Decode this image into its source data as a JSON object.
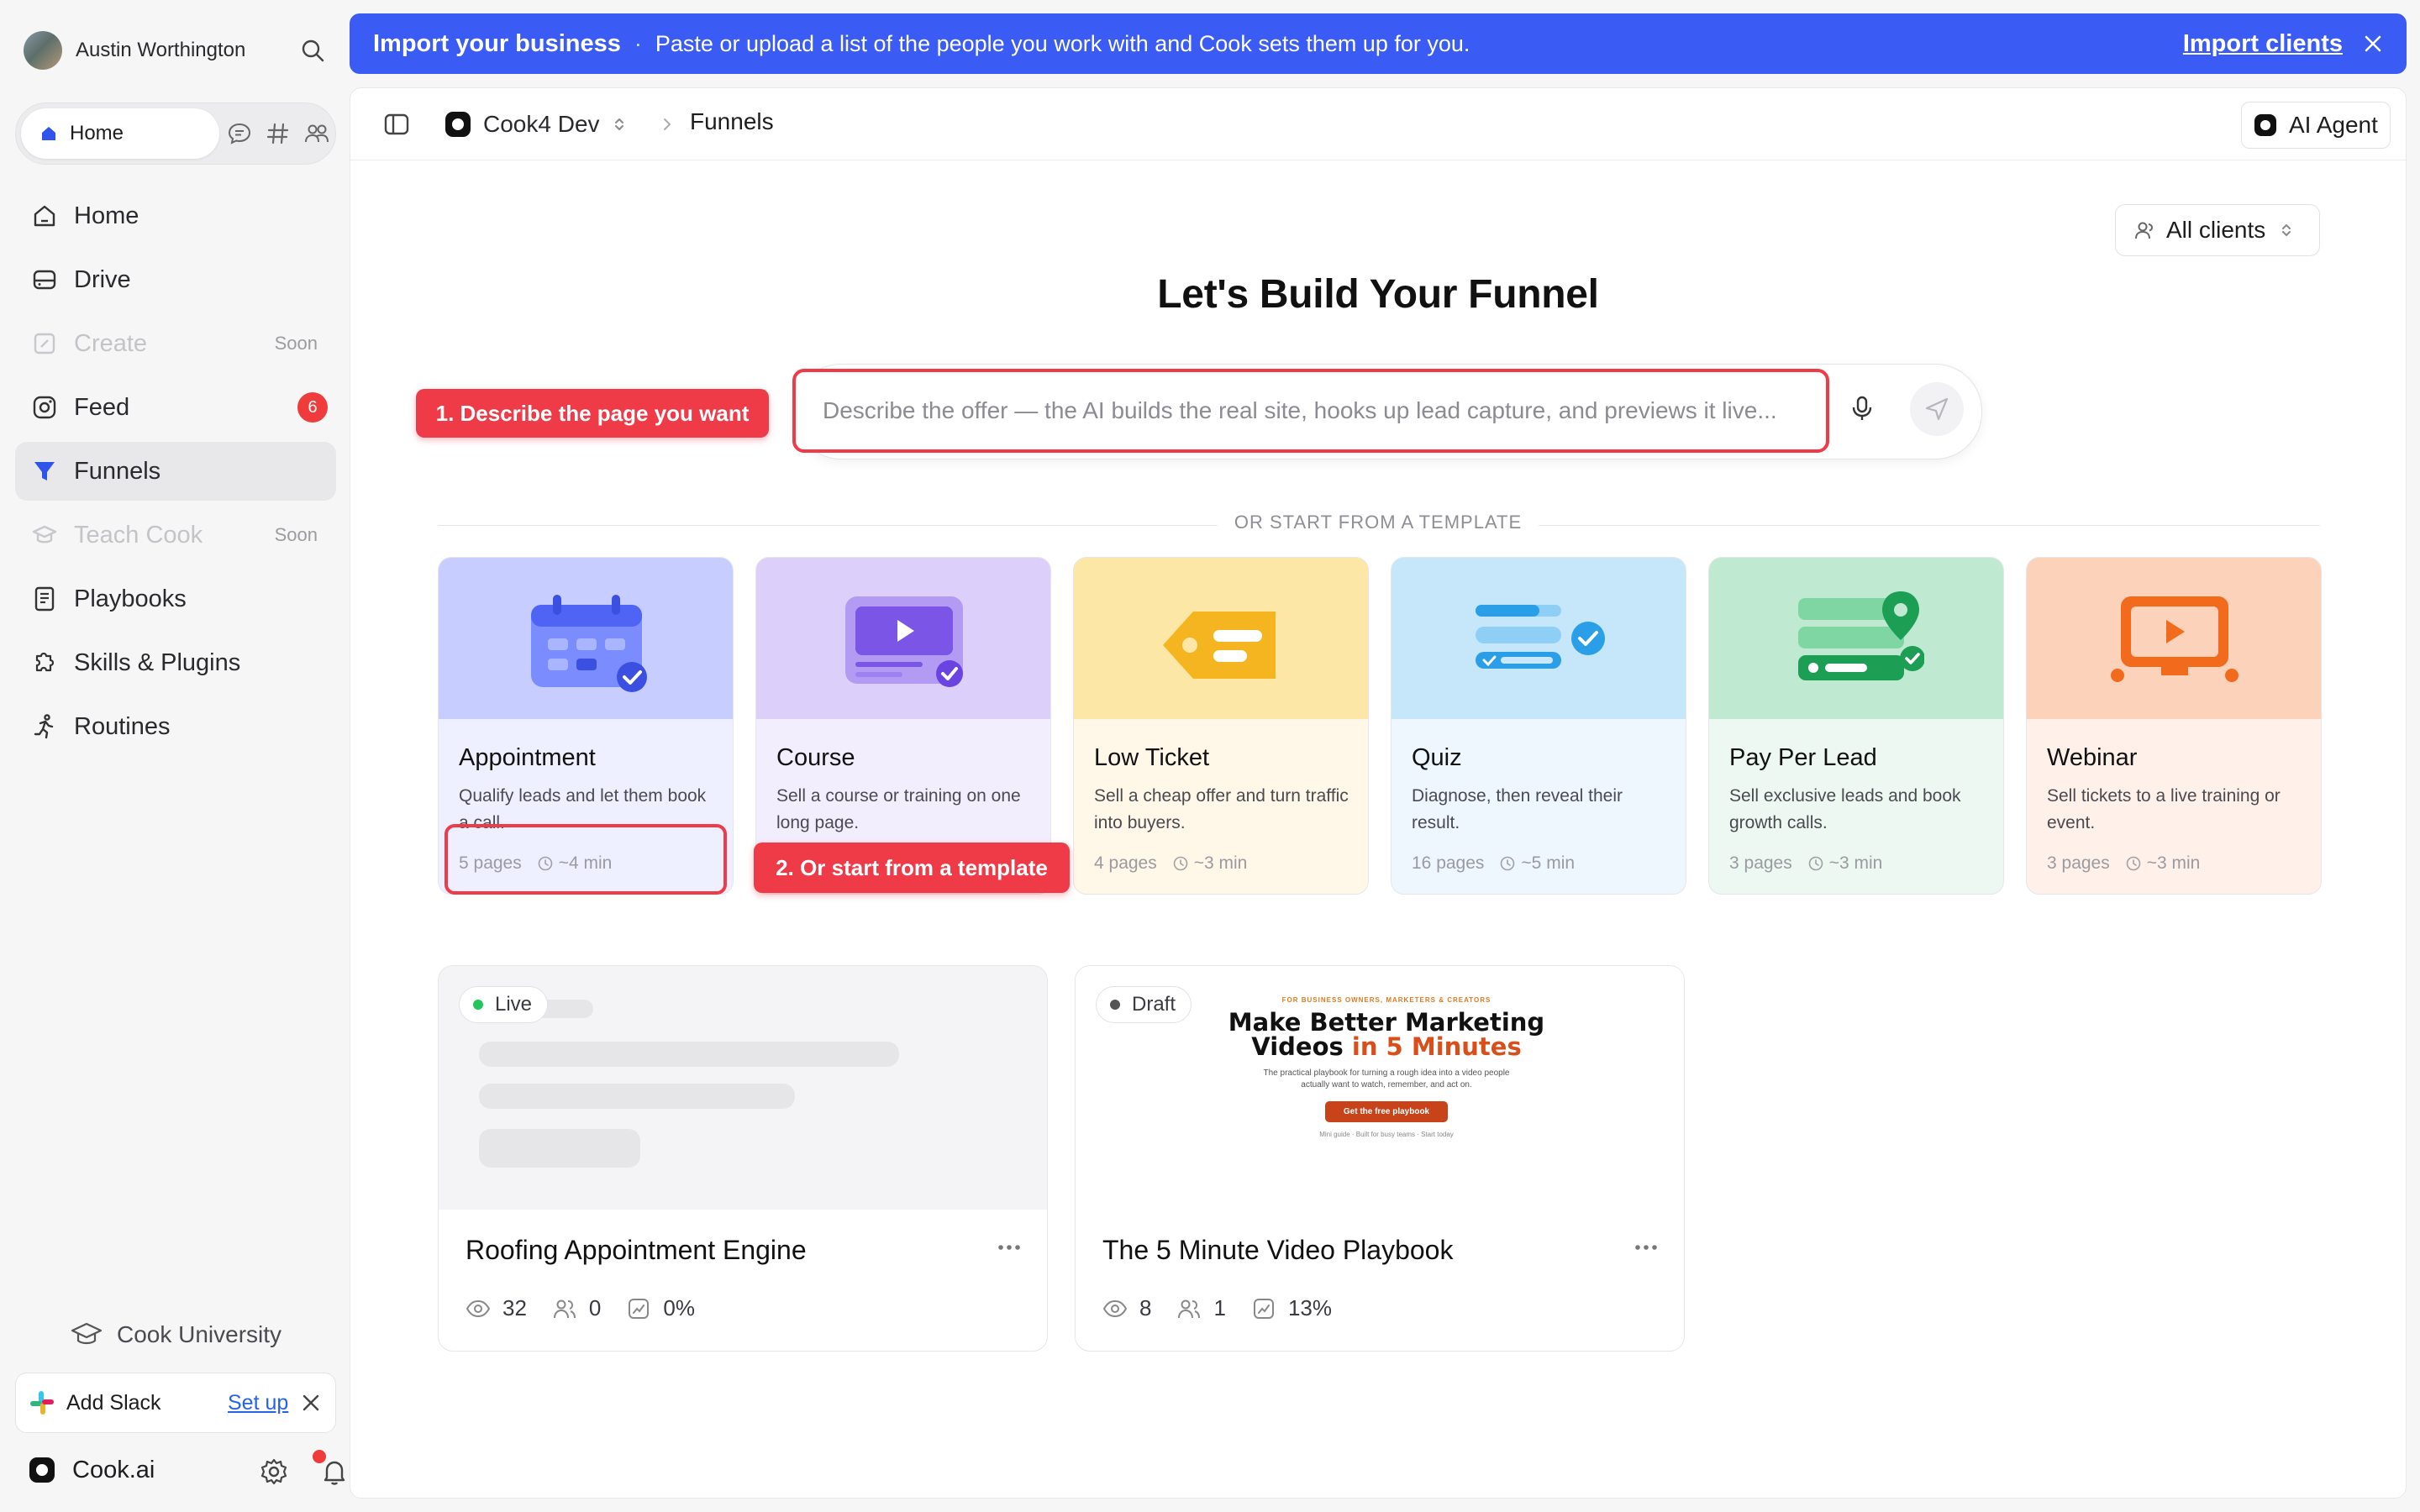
{
  "user": {
    "name": "Austin Worthington"
  },
  "mode_switch": {
    "active_label": "Home"
  },
  "nav": [
    {
      "label": "Home",
      "icon": "home-icon",
      "state": "normal"
    },
    {
      "label": "Drive",
      "icon": "drive-icon",
      "state": "normal"
    },
    {
      "label": "Create",
      "icon": "create-icon",
      "state": "disabled",
      "tag": "Soon"
    },
    {
      "label": "Feed",
      "icon": "feed-icon",
      "state": "normal",
      "badge": "6"
    },
    {
      "label": "Funnels",
      "icon": "funnel-icon",
      "state": "active"
    },
    {
      "label": "Teach Cook",
      "icon": "teach-icon",
      "state": "disabled",
      "tag": "Soon"
    },
    {
      "label": "Playbooks",
      "icon": "playbook-icon",
      "state": "normal"
    },
    {
      "label": "Skills & Plugins",
      "icon": "puzzle-icon",
      "state": "normal"
    },
    {
      "label": "Routines",
      "icon": "routine-icon",
      "state": "normal"
    }
  ],
  "sidebar_footer": {
    "university": "Cook University",
    "slack_label": "Add Slack",
    "slack_action": "Set up",
    "brand": "Cook.ai"
  },
  "banner": {
    "title": "Import your business",
    "separator": "·",
    "message": "Paste or upload a list of the people you work with and Cook sets them up for you.",
    "action": "Import clients",
    "color": "#3b5bf5"
  },
  "topbar": {
    "workspace": "Cook4 Dev",
    "breadcrumb": "Funnels",
    "agent_button": "AI Agent"
  },
  "filter": {
    "label": "All clients"
  },
  "headline": "Let's Build Your Funnel",
  "prompt": {
    "placeholder": "Describe the offer — the AI builds the real site, hooks up lead capture, and previews it live..."
  },
  "callouts": {
    "step1": "1. Describe the page you want",
    "step2": "2. Or start from a template",
    "color": "#ee3b47"
  },
  "divider_label": "OR START FROM A TEMPLATE",
  "templates": [
    {
      "title": "Appointment",
      "description": "Qualify leads and let them book a call.",
      "pages": "5 pages",
      "time": "~4 min",
      "bg": "#eef0ff",
      "art_bg": "#c7ceff"
    },
    {
      "title": "Course",
      "description": "Sell a course or training on one long page.",
      "pages": "",
      "time": "",
      "bg": "#f3eefe",
      "art_bg": "#dccff9"
    },
    {
      "title": "Low Ticket",
      "description": "Sell a cheap offer and turn traffic into buyers.",
      "pages": "4 pages",
      "time": "~3 min",
      "bg": "#fff8e8",
      "art_bg": "#fde7a6"
    },
    {
      "title": "Quiz",
      "description": "Diagnose, then reveal their result.",
      "pages": "16 pages",
      "time": "~5 min",
      "bg": "#eef7fd",
      "art_bg": "#c6e6fa"
    },
    {
      "title": "Pay Per Lead",
      "description": "Sell exclusive leads and book growth calls.",
      "pages": "3 pages",
      "time": "~3 min",
      "bg": "#ecf8f1",
      "art_bg": "#bfe9d0"
    },
    {
      "title": "Webinar",
      "description": "Sell tickets to a live training or event.",
      "pages": "3 pages",
      "time": "~3 min",
      "bg": "#fff1ea",
      "art_bg": "#fdd2bb"
    }
  ],
  "funnels": [
    {
      "name": "Roofing Appointment Engine",
      "status": "Live",
      "status_color": "#22c55e",
      "views": "32",
      "leads": "0",
      "conversion": "0%"
    },
    {
      "name": "The 5 Minute Video Playbook",
      "status": "Draft",
      "status_color": "#555555",
      "views": "8",
      "leads": "1",
      "conversion": "13%",
      "preview": {
        "kicker": "FOR BUSINESS OWNERS, MARKETERS & CREATORS",
        "title_line1": "Make Better Marketing",
        "title_line2": "Videos",
        "title_accent": "in 5 Minutes",
        "subtitle": "The practical playbook for turning a rough idea into a video people actually want to watch, remember, and act on.",
        "button": "Get the free playbook",
        "footer": "Mini guide · Built for busy teams · Start today"
      }
    }
  ]
}
